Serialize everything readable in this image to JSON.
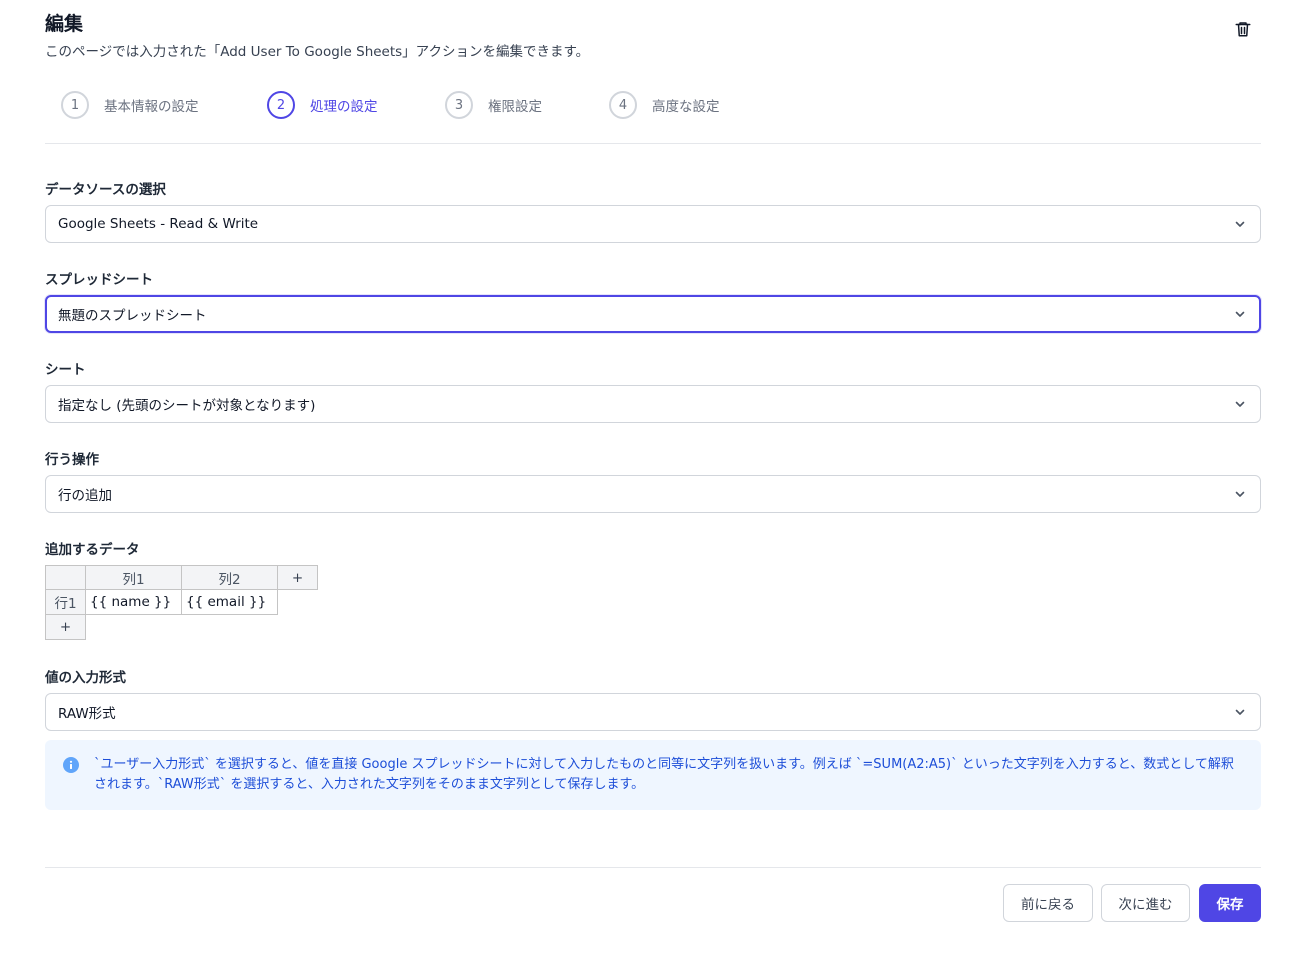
{
  "header": {
    "title": "編集",
    "subtitle": "このページでは入力された「Add User To Google Sheets」アクションを編集できます。",
    "delete_icon": "trash-icon"
  },
  "steps": [
    {
      "number": "1",
      "label": "基本情報の設定",
      "active": false
    },
    {
      "number": "2",
      "label": "処理の設定",
      "active": true
    },
    {
      "number": "3",
      "label": "権限設定",
      "active": false
    },
    {
      "number": "4",
      "label": "高度な設定",
      "active": false
    }
  ],
  "fields": {
    "datasource": {
      "label": "データソースの選択",
      "value": "Google Sheets - Read & Write"
    },
    "spreadsheet": {
      "label": "スプレッドシート",
      "value": "無題のスプレッドシート"
    },
    "sheet": {
      "label": "シート",
      "value": "指定なし (先頭のシートが対象となります)"
    },
    "operation": {
      "label": "行う操作",
      "value": "行の追加"
    },
    "data": {
      "label": "追加するデータ",
      "columns": [
        "列1",
        "列2"
      ],
      "add_column": "+",
      "add_row": "+",
      "rows": [
        {
          "header": "行1",
          "cells": [
            "{{ name }}",
            "{{ email }}"
          ]
        }
      ]
    },
    "input_format": {
      "label": "値の入力形式",
      "value": "RAW形式"
    }
  },
  "info": {
    "icon": "info-icon",
    "text": "`ユーザー入力形式` を選択すると、値を直接 Google スプレッドシートに対して入力したものと同等に文字列を扱います。例えば `=SUM(A2:A5)` といった文字列を入力すると、数式として解釈されます。`RAW形式` を選択すると、入力された文字列をそのまま文字列として保存します。"
  },
  "footer": {
    "back": "前に戻る",
    "next": "次に進む",
    "save": "保存"
  },
  "colors": {
    "accent": "#4f46e5",
    "info_bg": "#eff6ff",
    "info_text": "#1d4ed8"
  }
}
